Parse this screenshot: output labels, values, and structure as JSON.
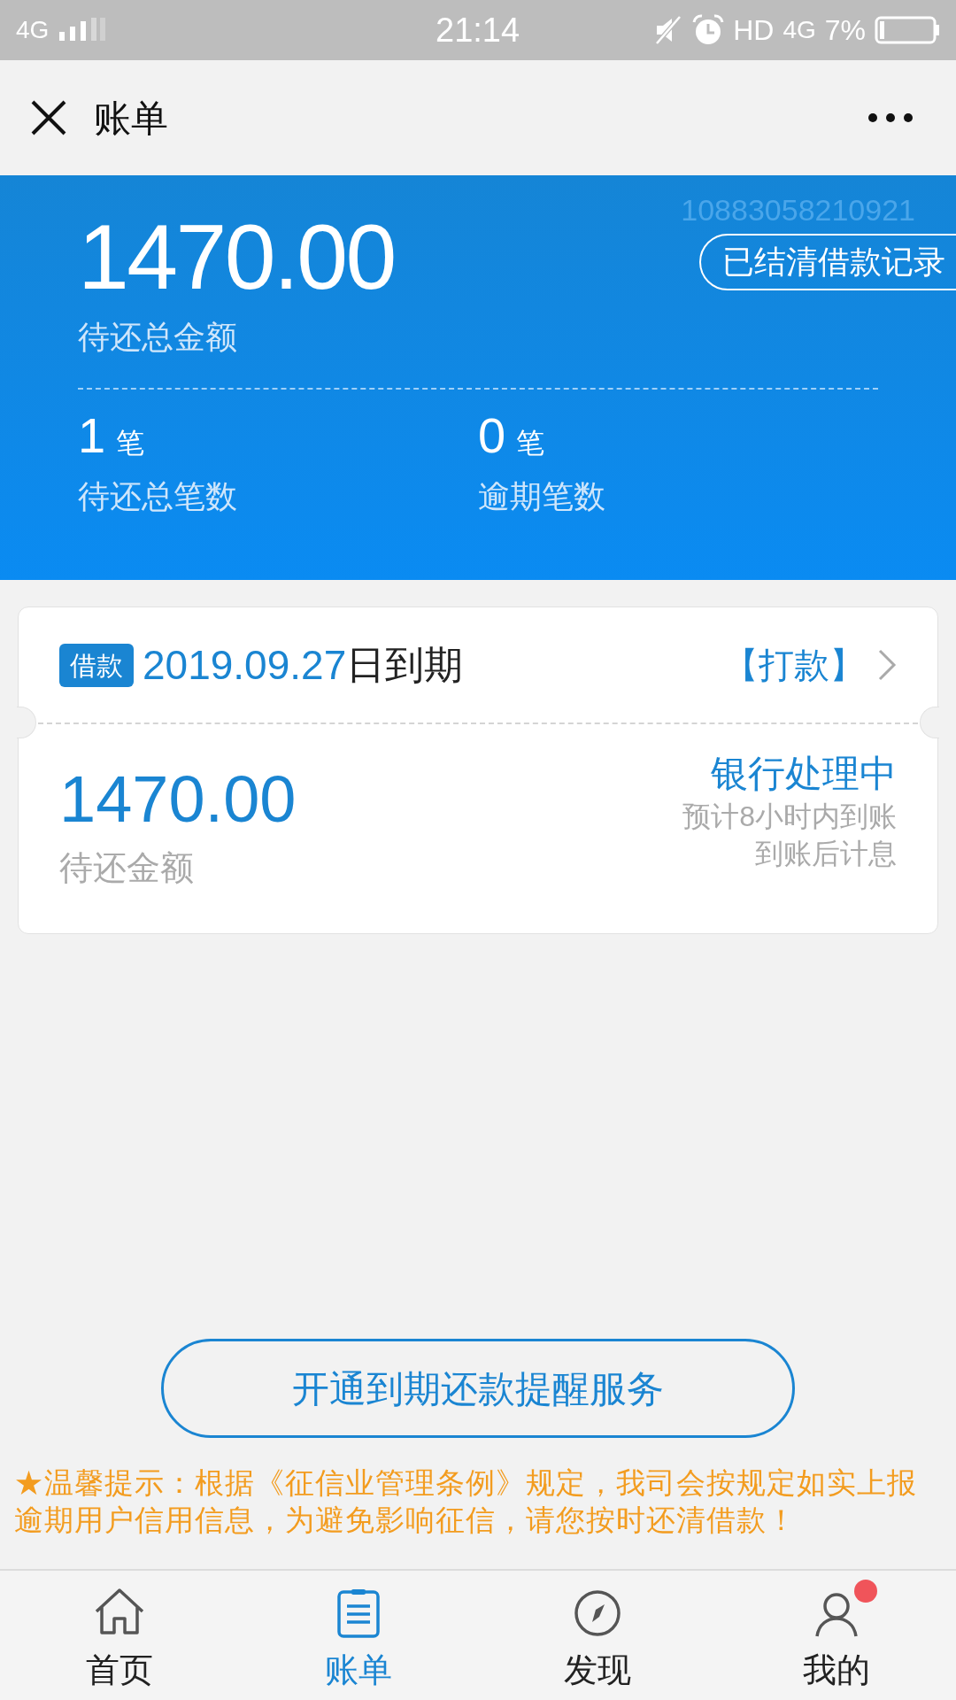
{
  "status_bar": {
    "network": "4G",
    "time": "21:14",
    "hd": "HD",
    "network_right": "4G",
    "battery": "7%"
  },
  "header": {
    "title": "账单"
  },
  "summary": {
    "account_number": "10883058210921",
    "total_amount": "1470.00",
    "total_label": "待还总金额",
    "records_button": "已结清借款记录",
    "stats": [
      {
        "value": "1",
        "unit": "笔",
        "label": "待还总笔数"
      },
      {
        "value": "0",
        "unit": "笔",
        "label": "逾期笔数"
      }
    ]
  },
  "loan_card": {
    "tag": "借款",
    "due_date": "2019.09.27",
    "due_suffix": "日到期",
    "action": "【打款】",
    "amount": "1470.00",
    "amount_label": "待还金额",
    "status": "银行处理中",
    "notes": [
      "预计8小时内到账",
      "到账后计息"
    ]
  },
  "remind_button": "开通到期还款提醒服务",
  "notice": "★温馨提示：根据《征信业管理条例》规定，我司会按规定如实上报逾期用户信用信息，为避免影响征信，请您按时还清借款！",
  "tabs": [
    {
      "label": "首页",
      "kind": "home",
      "selected": false,
      "dot": false
    },
    {
      "label": "账单",
      "kind": "bill",
      "selected": true,
      "dot": false
    },
    {
      "label": "发现",
      "kind": "discover",
      "selected": false,
      "dot": false
    },
    {
      "label": "我的",
      "kind": "me",
      "selected": false,
      "dot": true
    }
  ]
}
